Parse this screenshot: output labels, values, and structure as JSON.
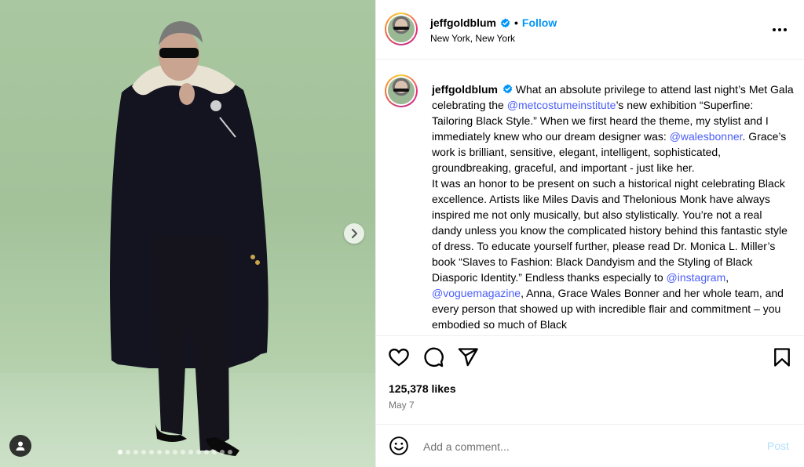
{
  "author": {
    "username": "jeffgoldblum",
    "location": "New York, New York",
    "follow_label": "Follow",
    "separator": "•",
    "verified": true
  },
  "caption": {
    "username": "jeffgoldblum",
    "parts": {
      "p1": " What an absolute privilege to attend last night’s Met Gala celebrating the ",
      "m1": "@metcostumeinstitute",
      "p2": "’s new exhibition “Superfine: Tailoring Black Style.” When we first heard the theme, my stylist and I immediately knew who our dream designer was: ",
      "m2": "@walesbonner",
      "p3": ". Grace’s work is brilliant, sensitive, elegant, intelligent, sophisticated, groundbreaking, graceful, and important - just like her.",
      "p4": "It was an honor to be present on such a historical night celebrating Black excellence. Artists like Miles Davis and Thelonious Monk have always inspired me not only musically, but also stylistically. You’re not a real dandy unless you know the complicated history behind this fantastic style of dress. To educate yourself further, please read Dr. Monica L. Miller’s book “Slaves to Fashion: Black Dandyism and the Styling of Black Diasporic Identity.” Endless thanks especially to ",
      "m3": "@instagram",
      "p5": ", ",
      "m4": "@voguemagazine",
      "p6": ", Anna, Grace Wales Bonner and her whole team, and every person that showed up with incredible flair and commitment – you embodied so much of Black"
    }
  },
  "actions": {
    "like_icon": "heart-icon",
    "comment_icon": "comment-icon",
    "share_icon": "share-icon",
    "save_icon": "bookmark-icon"
  },
  "likes_text": "125,378 likes",
  "date": "May 7",
  "comment": {
    "placeholder": "Add a comment...",
    "post_label": "Post"
  },
  "carousel": {
    "slide_count": 13,
    "active_index": 0
  },
  "colors": {
    "accent": "#0095f6",
    "post_disabled": "#b2dffc",
    "photo_bg": "#a9c7a0",
    "mention": "#4a5df9"
  }
}
